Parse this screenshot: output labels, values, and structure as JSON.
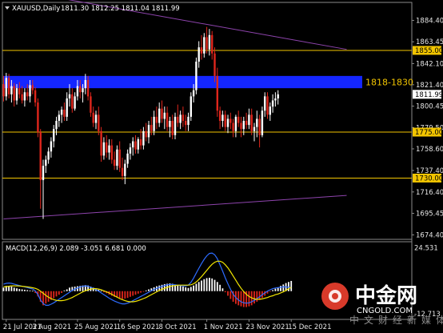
{
  "chart_data": {
    "type": "candlestick",
    "header": {
      "symbol": "XAUUSD,Daily",
      "ohlc": "1811.30 1812.25 1811.04 1811.99"
    },
    "price_axis": {
      "ylim": [
        1670,
        1902
      ],
      "ticks": [
        "1884.40",
        "1863.45",
        "1842.10",
        "1821.40",
        "1800.45",
        "1779.50",
        "1758.60",
        "1737.40",
        "1716.40",
        "1695.45",
        "1674.40"
      ],
      "tick_values": [
        1884.4,
        1863.45,
        1842.1,
        1821.4,
        1800.45,
        1779.5,
        1758.6,
        1737.4,
        1716.4,
        1695.45,
        1674.4
      ]
    },
    "time_axis": {
      "labels": [
        "21 Jul 2021",
        "3 Aug 2021",
        "25 Aug 2021",
        "16 Sep 2021",
        "8 Oct 2021",
        "1 Nov 2021",
        "23 Nov 2021",
        "15 Dec 2021"
      ],
      "label_index": [
        1,
        12,
        28,
        44,
        60,
        77,
        93,
        109
      ]
    },
    "horizontal_lines": [
      {
        "value": 1855.0,
        "label": "1855.00"
      },
      {
        "value": 1775.0,
        "label": "1775.00"
      },
      {
        "value": 1730.0,
        "label": "1730.00"
      }
    ],
    "current_price": {
      "value": 1811.99,
      "label": "1811.99"
    },
    "resistance_zone": {
      "low": 1818,
      "high": 1830,
      "label": "1818-1830"
    },
    "trendlines": [
      {
        "from": [
          0,
          1916
        ],
        "to": [
          130,
          1856
        ],
        "color": "#8e44ad"
      },
      {
        "from": [
          0,
          1690
        ],
        "to": [
          130,
          1713
        ],
        "color": "#8e44ad"
      }
    ],
    "colors": {
      "up": "#ffffff",
      "down": "#e0261c",
      "level": "#f2c500",
      "zone": "#1426ff",
      "trend": "#8e44ad",
      "signal": "#f2e600",
      "macd_line": "#2d6cff"
    },
    "candles_ohlc": [
      [
        1822,
        1830,
        1805,
        1810
      ],
      [
        1810,
        1833,
        1806,
        1828
      ],
      [
        1828,
        1832,
        1808,
        1812
      ],
      [
        1812,
        1826,
        1804,
        1820
      ],
      [
        1820,
        1823,
        1800,
        1806
      ],
      [
        1806,
        1822,
        1802,
        1818
      ],
      [
        1818,
        1824,
        1808,
        1812
      ],
      [
        1812,
        1820,
        1803,
        1806
      ],
      [
        1806,
        1818,
        1800,
        1814
      ],
      [
        1814,
        1822,
        1806,
        1810
      ],
      [
        1810,
        1826,
        1804,
        1821
      ],
      [
        1821,
        1826,
        1812,
        1816
      ],
      [
        1816,
        1819,
        1800,
        1804
      ],
      [
        1804,
        1808,
        1770,
        1775
      ],
      [
        1775,
        1778,
        1700,
        1728
      ],
      [
        1728,
        1748,
        1690,
        1742
      ],
      [
        1742,
        1752,
        1735,
        1748
      ],
      [
        1748,
        1760,
        1744,
        1756
      ],
      [
        1756,
        1770,
        1750,
        1766
      ],
      [
        1766,
        1782,
        1760,
        1778
      ],
      [
        1778,
        1790,
        1772,
        1786
      ],
      [
        1786,
        1796,
        1780,
        1792
      ],
      [
        1792,
        1800,
        1784,
        1797
      ],
      [
        1797,
        1804,
        1786,
        1790
      ],
      [
        1790,
        1814,
        1786,
        1808
      ],
      [
        1808,
        1822,
        1800,
        1812
      ],
      [
        1812,
        1818,
        1794,
        1798
      ],
      [
        1798,
        1814,
        1796,
        1810
      ],
      [
        1810,
        1826,
        1806,
        1820
      ],
      [
        1820,
        1826,
        1808,
        1814
      ],
      [
        1814,
        1822,
        1804,
        1818
      ],
      [
        1818,
        1832,
        1812,
        1826
      ],
      [
        1826,
        1830,
        1806,
        1810
      ],
      [
        1810,
        1814,
        1790,
        1794
      ],
      [
        1794,
        1800,
        1780,
        1784
      ],
      [
        1784,
        1796,
        1778,
        1792
      ],
      [
        1792,
        1800,
        1772,
        1776
      ],
      [
        1776,
        1780,
        1746,
        1752
      ],
      [
        1752,
        1770,
        1748,
        1765
      ],
      [
        1765,
        1772,
        1750,
        1755
      ],
      [
        1755,
        1768,
        1748,
        1762
      ],
      [
        1762,
        1768,
        1744,
        1748
      ],
      [
        1748,
        1756,
        1738,
        1742
      ],
      [
        1742,
        1762,
        1738,
        1758
      ],
      [
        1758,
        1766,
        1736,
        1740
      ],
      [
        1740,
        1750,
        1728,
        1732
      ],
      [
        1732,
        1748,
        1724,
        1744
      ],
      [
        1744,
        1758,
        1740,
        1754
      ],
      [
        1754,
        1764,
        1748,
        1760
      ],
      [
        1760,
        1770,
        1752,
        1766
      ],
      [
        1766,
        1772,
        1754,
        1758
      ],
      [
        1758,
        1770,
        1754,
        1768
      ],
      [
        1768,
        1778,
        1758,
        1762
      ],
      [
        1762,
        1780,
        1758,
        1776
      ],
      [
        1776,
        1784,
        1766,
        1770
      ],
      [
        1770,
        1786,
        1764,
        1782
      ],
      [
        1782,
        1790,
        1772,
        1776
      ],
      [
        1776,
        1796,
        1772,
        1790
      ],
      [
        1790,
        1800,
        1778,
        1784
      ],
      [
        1784,
        1804,
        1780,
        1798
      ],
      [
        1798,
        1806,
        1784,
        1788
      ],
      [
        1788,
        1800,
        1778,
        1794
      ],
      [
        1794,
        1800,
        1776,
        1780
      ],
      [
        1780,
        1790,
        1770,
        1786
      ],
      [
        1786,
        1792,
        1768,
        1772
      ],
      [
        1772,
        1794,
        1768,
        1790
      ],
      [
        1790,
        1802,
        1780,
        1784
      ],
      [
        1784,
        1796,
        1778,
        1792
      ],
      [
        1792,
        1800,
        1780,
        1786
      ],
      [
        1786,
        1792,
        1776,
        1782
      ],
      [
        1782,
        1794,
        1776,
        1790
      ],
      [
        1790,
        1814,
        1786,
        1810
      ],
      [
        1810,
        1822,
        1804,
        1816
      ],
      [
        1816,
        1848,
        1812,
        1844
      ],
      [
        1844,
        1864,
        1838,
        1858
      ],
      [
        1858,
        1870,
        1846,
        1852
      ],
      [
        1852,
        1872,
        1848,
        1868
      ],
      [
        1868,
        1878,
        1852,
        1856
      ],
      [
        1856,
        1876,
        1850,
        1870
      ],
      [
        1870,
        1874,
        1846,
        1852
      ],
      [
        1852,
        1858,
        1824,
        1830
      ],
      [
        1830,
        1838,
        1790,
        1796
      ],
      [
        1796,
        1800,
        1778,
        1786
      ],
      [
        1786,
        1796,
        1780,
        1792
      ],
      [
        1792,
        1796,
        1776,
        1780
      ],
      [
        1780,
        1792,
        1774,
        1788
      ],
      [
        1788,
        1794,
        1778,
        1784
      ],
      [
        1784,
        1788,
        1770,
        1776
      ],
      [
        1776,
        1792,
        1770,
        1790
      ],
      [
        1790,
        1796,
        1780,
        1784
      ],
      [
        1784,
        1790,
        1770,
        1778
      ],
      [
        1778,
        1790,
        1772,
        1786
      ],
      [
        1786,
        1794,
        1778,
        1782
      ],
      [
        1782,
        1798,
        1778,
        1792
      ],
      [
        1792,
        1798,
        1772,
        1776
      ],
      [
        1776,
        1784,
        1766,
        1780
      ],
      [
        1780,
        1796,
        1770,
        1788
      ],
      [
        1788,
        1792,
        1760,
        1772
      ],
      [
        1772,
        1800,
        1770,
        1796
      ],
      [
        1796,
        1814,
        1790,
        1810
      ],
      [
        1810,
        1814,
        1788,
        1792
      ],
      [
        1792,
        1804,
        1786,
        1800
      ],
      [
        1800,
        1812,
        1794,
        1806
      ],
      [
        1806,
        1814,
        1800,
        1808
      ],
      [
        1808,
        1816,
        1802,
        1811.99
      ]
    ],
    "macd": {
      "label": "MACD(12,26,9) 2.089 -3.051 6.681 0.000",
      "ylim": [
        -16,
        28
      ],
      "ticks": [
        "24.531",
        "-12.713"
      ],
      "tick_values": [
        24.531,
        -12.713
      ],
      "histogram": [
        2,
        3,
        3,
        2.6,
        2,
        1.6,
        1.2,
        1.0,
        0.8,
        0.6,
        0.4,
        0.2,
        -1,
        -3,
        -6,
        -8,
        -7,
        -6,
        -5,
        -4,
        -3,
        -2,
        -1,
        0.4,
        1,
        2,
        2.4,
        2.6,
        2.8,
        3,
        3.2,
        3.4,
        3.2,
        2.6,
        2,
        1.4,
        0.8,
        0.2,
        -0.6,
        -1.2,
        -2,
        -2.6,
        -3.2,
        -3.6,
        -4,
        -4.4,
        -4.2,
        -3.8,
        -3.2,
        -2.6,
        -2,
        -1.4,
        -0.8,
        -0.2,
        0.4,
        1,
        1.6,
        2.2,
        2.8,
        3.2,
        3.6,
        4,
        4.2,
        4.4,
        4.2,
        3.8,
        3.4,
        3,
        2.6,
        2.2,
        1.8,
        2.4,
        3.2,
        4.2,
        5.2,
        6,
        6.8,
        7.4,
        7.6,
        7.2,
        6.4,
        5.2,
        3.6,
        1.6,
        -0.6,
        -2.6,
        -4.4,
        -6,
        -7.2,
        -8,
        -8.6,
        -9,
        -9,
        -8.6,
        -8,
        -7,
        -6,
        -5,
        -3.8,
        -2.6,
        -1.4,
        -0.4,
        0.6,
        1.4,
        2.2,
        3,
        3.8,
        4.6,
        5.2,
        5.8
      ],
      "macd_line": [
        4,
        4.4,
        4.6,
        4.4,
        4,
        3.6,
        3.2,
        2.8,
        2.4,
        2,
        1.6,
        1.2,
        0.2,
        -2,
        -5,
        -7,
        -8,
        -8,
        -7.4,
        -6.6,
        -5.6,
        -4.6,
        -3.6,
        -2.6,
        -1.6,
        -0.6,
        0.4,
        1.2,
        1.8,
        2.4,
        2.8,
        3,
        2.8,
        2.2,
        1.6,
        0.8,
        0,
        -1,
        -2,
        -3,
        -4,
        -4.8,
        -5.6,
        -6.2,
        -6.8,
        -7.2,
        -7.2,
        -6.8,
        -6.2,
        -5.4,
        -4.6,
        -3.8,
        -3,
        -2.2,
        -1.4,
        -0.6,
        0.2,
        1,
        1.6,
        2.2,
        2.8,
        3.2,
        3.6,
        3.8,
        3.8,
        3.6,
        3.4,
        3.2,
        3,
        3,
        3.4,
        5,
        7.4,
        10.2,
        13,
        15.6,
        18,
        20,
        21.4,
        21.6,
        20.6,
        18.4,
        15,
        11.4,
        7.6,
        4.2,
        1,
        -1.6,
        -3.6,
        -5,
        -6,
        -6.6,
        -6.8,
        -6.6,
        -6,
        -5.2,
        -4.2,
        -3.2,
        -2,
        -1,
        0,
        0.8,
        1.4,
        1.8,
        2,
        2.2,
        2.4,
        2.4,
        2.2,
        2.089
      ],
      "signal_line": [
        2.4,
        2.6,
        2.8,
        3,
        3,
        3,
        2.9,
        2.8,
        2.6,
        2.4,
        2.2,
        1.9,
        1.6,
        1,
        0,
        -1.2,
        -2.4,
        -3.4,
        -4.2,
        -4.8,
        -5.2,
        -5.4,
        -5.4,
        -5.2,
        -4.8,
        -4.2,
        -3.6,
        -2.8,
        -2,
        -1.2,
        -0.4,
        0.2,
        0.8,
        1.2,
        1.4,
        1.4,
        1.2,
        0.8,
        0.2,
        -0.4,
        -1,
        -1.8,
        -2.6,
        -3.4,
        -4.2,
        -4.8,
        -5.4,
        -5.8,
        -6,
        -6,
        -5.8,
        -5.4,
        -4.8,
        -4.2,
        -3.6,
        -2.8,
        -2,
        -1.2,
        -0.4,
        0.4,
        1,
        1.6,
        2.2,
        2.6,
        3,
        3.2,
        3.4,
        3.4,
        3.4,
        3.4,
        3.4,
        3.6,
        4.2,
        5.2,
        6.6,
        8.2,
        10,
        11.8,
        13.6,
        15.2,
        16.4,
        17,
        17,
        16.4,
        15,
        13.2,
        11,
        8.6,
        6.2,
        3.8,
        1.6,
        -0.2,
        -1.8,
        -3,
        -3.8,
        -4.4,
        -4.6,
        -4.6,
        -4.4,
        -4,
        -3.6,
        -3,
        -2.6,
        -2,
        -1.6,
        -1,
        -0.4,
        0.4,
        1.4,
        2.2
      ]
    }
  },
  "watermark": {
    "cn_title": "中金网",
    "url": "CNGOLD.COM",
    "subtitle": "中文财经新媒体"
  }
}
